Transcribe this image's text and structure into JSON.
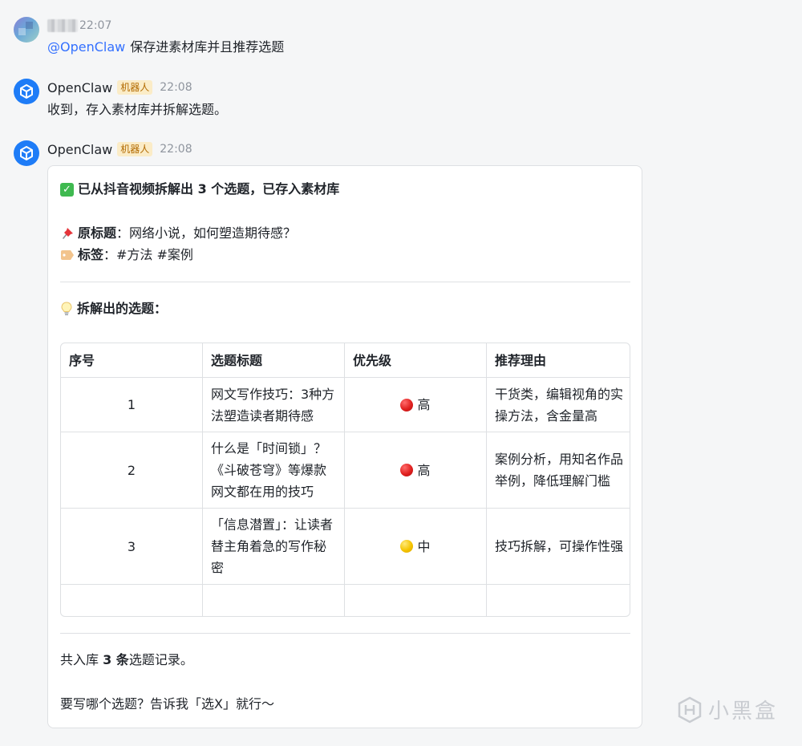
{
  "messages": [
    {
      "sender": "",
      "time": "22:07",
      "mention": "@OpenClaw",
      "text": "保存进素材库并且推荐选题"
    },
    {
      "sender": "OpenClaw",
      "badge": "机器人",
      "time": "22:08",
      "text": "收到，存入素材库并拆解选题。"
    },
    {
      "sender": "OpenClaw",
      "badge": "机器人",
      "time": "22:08"
    }
  ],
  "card": {
    "title": "已从抖音视频拆解出 3 个选题，已存入素材库",
    "original_title_label": "原标题",
    "original_title_value": "：网络小说，如何塑造期待感？",
    "tags_label": "标签",
    "tags_value": "：#方法 #案例",
    "topics_heading": "拆解出的选题：",
    "table": {
      "headers": [
        "序号",
        "选题标题",
        "优先级",
        "推荐理由"
      ],
      "rows": [
        {
          "no": "1",
          "title": "网文写作技巧：3种方法塑造读者期待感",
          "priority": "高",
          "priority_color": "#e0201f",
          "reason": "干货类，编辑视角的实操方法，含金量高"
        },
        {
          "no": "2",
          "title": "什么是「时间锁」？《斗破苍穹》等爆款网文都在用的技巧",
          "priority": "高",
          "priority_color": "#e0201f",
          "reason": "案例分析，用知名作品举例，降低理解门槛"
        },
        {
          "no": "3",
          "title": "「信息潜置」：让读者替主角着急的写作秘密",
          "priority": "中",
          "priority_color": "#f5c400",
          "reason": "技巧拆解，可操作性强"
        }
      ]
    },
    "summary_prefix": "共入库 ",
    "summary_count": "3 条",
    "summary_suffix": "选题记录。",
    "closing": "要写哪个选题？告诉我「选X」就行～"
  },
  "watermark": "小黑盒",
  "icons": {
    "check": "check-mark-button-icon",
    "pin": "pushpin-icon",
    "tag": "label-tag-icon",
    "bulb": "light-bulb-icon",
    "bot_avatar": "cube-icon",
    "watermark": "heybox-logo-icon"
  }
}
